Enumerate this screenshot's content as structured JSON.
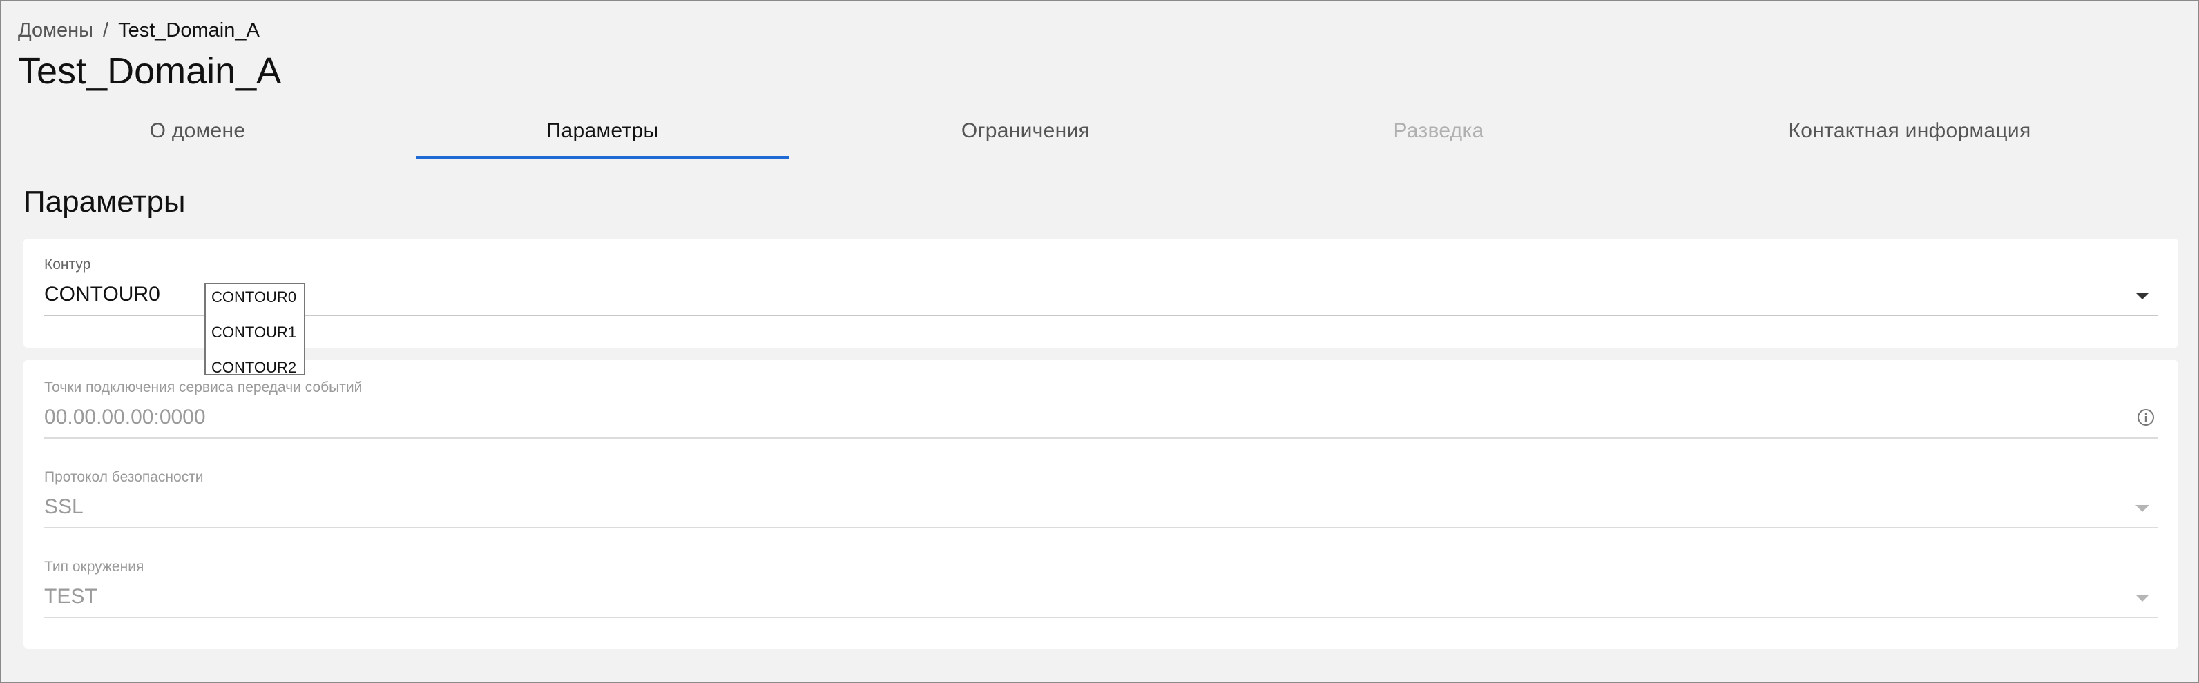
{
  "breadcrumb": {
    "parent": "Домены",
    "separator": "/",
    "current": "Test_Domain_A"
  },
  "page": {
    "title": "Test_Domain_A"
  },
  "tabs": [
    {
      "label": "О домене",
      "state": "normal"
    },
    {
      "label": "Параметры",
      "state": "active"
    },
    {
      "label": "Ограничения",
      "state": "normal"
    },
    {
      "label": "Разведка",
      "state": "disabled"
    },
    {
      "label": "Контактная информация",
      "state": "normal"
    }
  ],
  "section": {
    "title": "Параметры"
  },
  "contour": {
    "label": "Контур",
    "value": "CONTOUR0",
    "icon": "chevron-down-icon",
    "options": [
      "CONTOUR0",
      "CONTOUR1",
      "CONTOUR2"
    ]
  },
  "endpoints": {
    "label": "Точки подключения сервиса передачи событий",
    "placeholder": "00.00.00.00:0000",
    "icon": "info-icon"
  },
  "protocol": {
    "label": "Протокол безопасности",
    "value": "SSL",
    "icon": "chevron-down-icon"
  },
  "environment": {
    "label": "Тип окружения",
    "value": "TEST",
    "icon": "chevron-down-icon"
  },
  "colors": {
    "accent": "#1f6bd6",
    "background": "#f2f2f2",
    "card": "#ffffff",
    "disabled_text": "#9a9a9a"
  }
}
